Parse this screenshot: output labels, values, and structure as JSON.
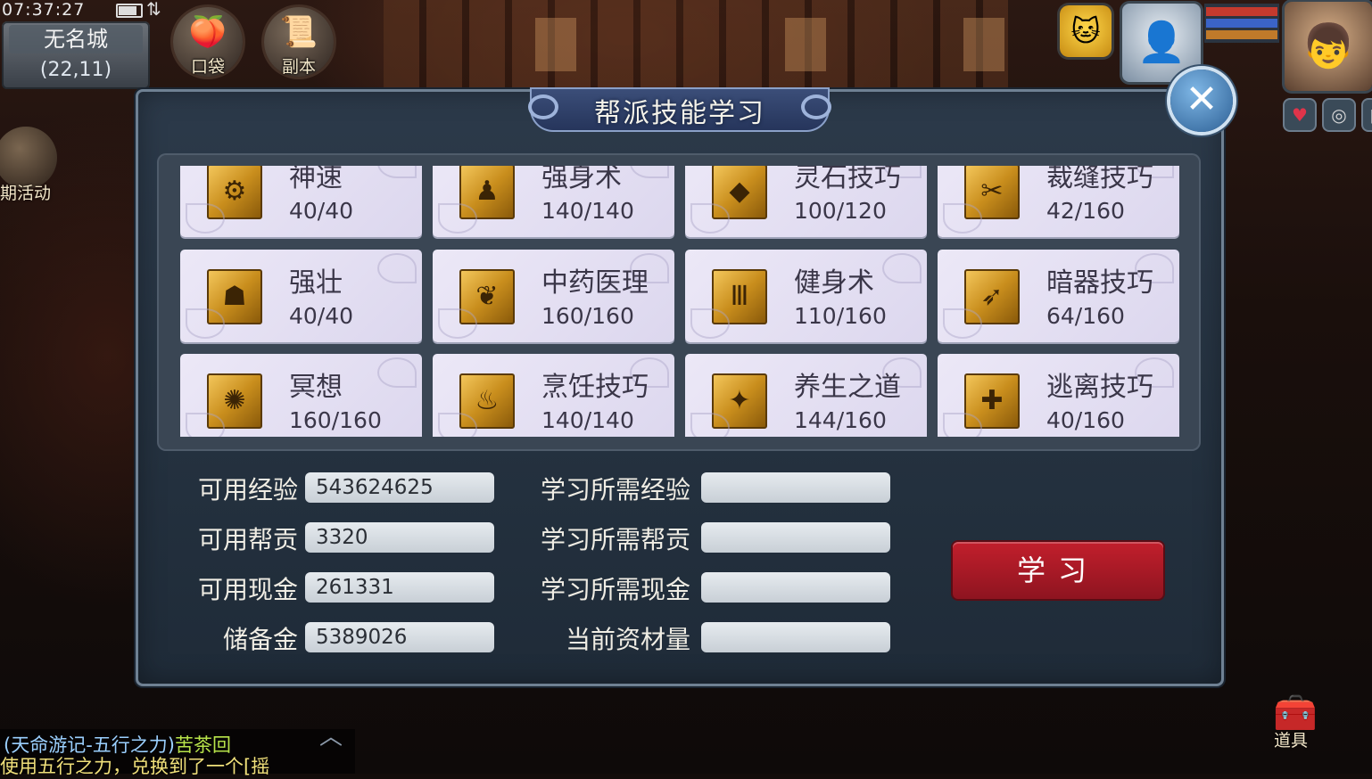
{
  "status": {
    "time": "07:37:27",
    "signal": "⇅"
  },
  "location": {
    "city": "无名城",
    "coords": "(22,11)"
  },
  "hud": {
    "pocket_label": "口袋",
    "dungeon_label": "副本",
    "activity_label": "期活动",
    "pocket_icon": "pocket-icon",
    "dungeon_icon": "scroll-icon"
  },
  "dialog": {
    "title": "帮派技能学习",
    "close_label": "✕",
    "skills": [
      {
        "name": "神速",
        "level": "40/40",
        "glyph": "⚙"
      },
      {
        "name": "强身术",
        "level": "140/140",
        "glyph": "♟"
      },
      {
        "name": "灵石技巧",
        "level": "100/120",
        "glyph": "◆"
      },
      {
        "name": "裁缝技巧",
        "level": "42/160",
        "glyph": "✂"
      },
      {
        "name": "强壮",
        "level": "40/40",
        "glyph": "☗"
      },
      {
        "name": "中药医理",
        "level": "160/160",
        "glyph": "❦"
      },
      {
        "name": "健身术",
        "level": "110/160",
        "glyph": "Ⅲ"
      },
      {
        "name": "暗器技巧",
        "level": "64/160",
        "glyph": "➶"
      },
      {
        "name": "冥想",
        "level": "160/160",
        "glyph": "✺"
      },
      {
        "name": "烹饪技巧",
        "level": "140/140",
        "glyph": "♨"
      },
      {
        "name": "养生之道",
        "level": "144/160",
        "glyph": "✦"
      },
      {
        "name": "逃离技巧",
        "level": "40/160",
        "glyph": "✚"
      }
    ],
    "stats_left": [
      {
        "label": "可用经验",
        "value": "543624625"
      },
      {
        "label": "可用帮贡",
        "value": "3320"
      },
      {
        "label": "可用现金",
        "value": "261331"
      },
      {
        "label": "储备金",
        "value": "5389026"
      }
    ],
    "stats_right": [
      {
        "label": "学习所需经验",
        "value": ""
      },
      {
        "label": "学习所需帮贡",
        "value": ""
      },
      {
        "label": "学习所需现金",
        "value": ""
      },
      {
        "label": "当前资材量",
        "value": ""
      }
    ],
    "learn_button": "学习"
  },
  "chat": {
    "line1_channel": "(天命游记-五行之力)",
    "line1_name": "苦茶回",
    "line2": "使用五行之力，兑换到了一个[摇"
  },
  "items_label": "道具",
  "colors": {
    "card_bg": "#e4e0f3",
    "icon_gold": "#d9a53a",
    "learn_btn": "#a81a26",
    "dialog_bg": "#2a3847",
    "title_plate": "#2f4068"
  }
}
